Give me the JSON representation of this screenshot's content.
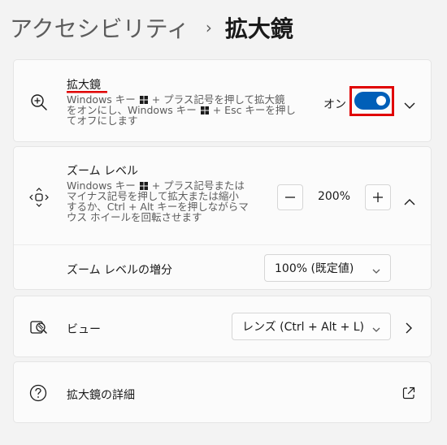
{
  "breadcrumb": {
    "parent": "アクセシビリティ",
    "separator": "›",
    "current": "拡大鏡"
  },
  "magnifier": {
    "title": "拡大鏡",
    "description_lines": [
      [
        "Windows キー ",
        "winkey",
        " + プラス記号を押して拡大鏡"
      ],
      [
        "をオンにし、Windows キー ",
        "winkey",
        " + Esc キーを押し"
      ],
      [
        "てオフにします"
      ]
    ],
    "toggle_label": "オン",
    "toggle_on": true,
    "icon": "zoom-in-icon",
    "expand_icon": "chevron-down-icon"
  },
  "zoom_level": {
    "title": "ズーム レベル",
    "description_lines": [
      [
        "Windows キー ",
        "winkey",
        " + プラス記号または"
      ],
      [
        "マイナス記号を押して拡大または縮小"
      ],
      [
        "するか、Ctrl + Alt キーを押しながらマ"
      ],
      [
        "ウス ホイールを回転させます"
      ]
    ],
    "value": "200%",
    "decrease_label": "−",
    "increase_label": "+",
    "icon": "move-arrows-icon",
    "collapse_icon": "chevron-up-icon",
    "increment": {
      "label": "ズーム レベルの増分",
      "selected": "100% (既定値)"
    }
  },
  "view": {
    "label": "ビュー",
    "selected": "レンズ (Ctrl + Alt + L)",
    "icon": "view-icon",
    "navigate_icon": "chevron-right-icon"
  },
  "details": {
    "label": "拡大鏡の詳細",
    "icon": "help-circle-icon",
    "external_icon": "open-external-icon"
  },
  "colors": {
    "accent": "#005fb8",
    "highlight": "#e00000"
  }
}
